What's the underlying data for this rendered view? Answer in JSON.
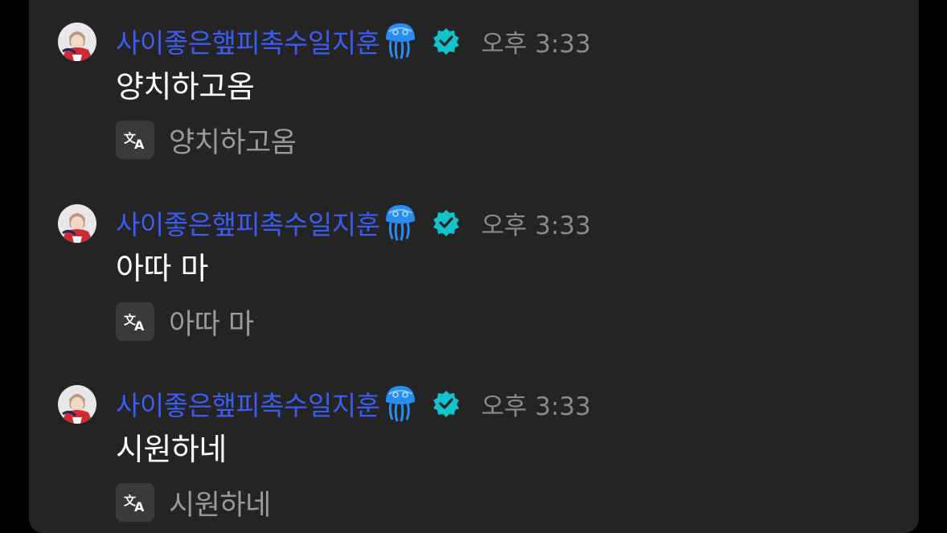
{
  "messages": [
    {
      "username": "사이좋은햎피촉수일지훈",
      "user_icon": "jellyfish-icon",
      "verified_icon": "verified-badge-icon",
      "time": "오후 3:33",
      "text": "양치하고옴",
      "translation": "양치하고옴"
    },
    {
      "username": "사이좋은햎피촉수일지훈",
      "user_icon": "jellyfish-icon",
      "verified_icon": "verified-badge-icon",
      "time": "오후 3:33",
      "text": "아따 마",
      "translation": "아따 마"
    },
    {
      "username": "사이좋은햎피촉수일지훈",
      "user_icon": "jellyfish-icon",
      "verified_icon": "verified-badge-icon",
      "time": "오후 3:33",
      "text": "시원하네",
      "translation": "시원하네"
    }
  ],
  "translate_icon": "translate-icon",
  "colors": {
    "background": "#000000",
    "panel": "#242424",
    "username": "#3c5bf0",
    "timestamp": "#8a8a8a",
    "message_text": "#ffffff",
    "translation_text": "#9a9a9a",
    "verified": "#12c3c9",
    "jellyfish": "#2a8cf0"
  }
}
